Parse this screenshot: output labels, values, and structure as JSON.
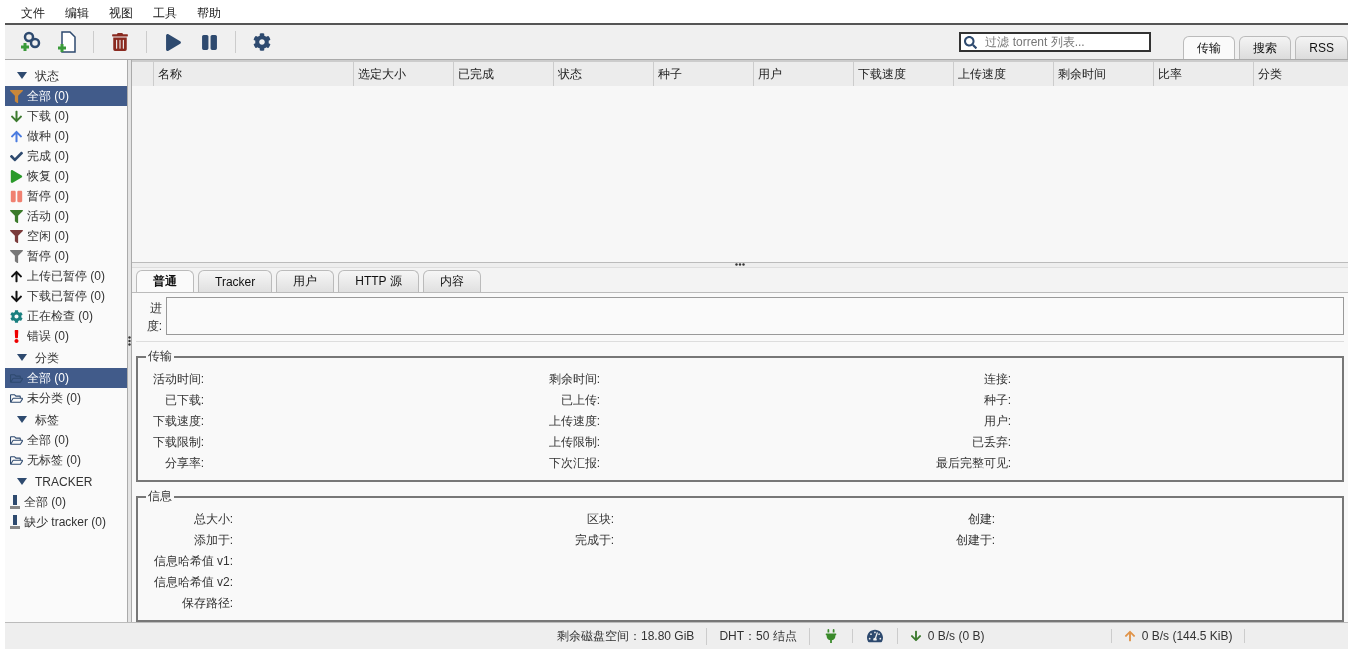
{
  "menu": [
    {
      "label": "文件"
    },
    {
      "label": "编辑"
    },
    {
      "label": "视图"
    },
    {
      "label": "工具"
    },
    {
      "label": "帮助"
    }
  ],
  "toolbar": {
    "filter": {
      "placeholder": "过滤 torrent 列表..."
    }
  },
  "view_tabs": [
    {
      "label": "传输",
      "selected": true
    },
    {
      "label": "搜索",
      "selected": false
    },
    {
      "label": "RSS",
      "selected": false
    }
  ],
  "sidebar": {
    "sections": [
      {
        "title": "状态",
        "expanded": true,
        "items": [
          {
            "label": "全部 (0)",
            "selected": true
          },
          {
            "label": "下载 (0)",
            "selected": false
          },
          {
            "label": "做种 (0)",
            "selected": false
          },
          {
            "label": "完成 (0)",
            "selected": false
          },
          {
            "label": "恢复 (0)",
            "selected": false
          },
          {
            "label": "暂停 (0)",
            "selected": false
          },
          {
            "label": "活动 (0)",
            "selected": false
          },
          {
            "label": "空闲 (0)",
            "selected": false
          },
          {
            "label": "暂停 (0)",
            "selected": false
          },
          {
            "label": "上传已暂停 (0)",
            "selected": false
          },
          {
            "label": "下载已暂停 (0)",
            "selected": false
          },
          {
            "label": "正在检查 (0)",
            "selected": false
          },
          {
            "label": "错误 (0)",
            "selected": false
          }
        ]
      },
      {
        "title": "分类",
        "expanded": true,
        "items": [
          {
            "label": "全部 (0)",
            "selected": true
          },
          {
            "label": "未分类 (0)",
            "selected": false
          }
        ]
      },
      {
        "title": "标签",
        "expanded": true,
        "items": [
          {
            "label": "全部 (0)",
            "selected": false
          },
          {
            "label": "无标签 (0)",
            "selected": false
          }
        ]
      },
      {
        "title": "TRACKER",
        "expanded": true,
        "items": [
          {
            "label": "全部 (0)",
            "selected": false
          },
          {
            "label": "缺少 tracker (0)",
            "selected": false
          }
        ]
      }
    ]
  },
  "table": {
    "columns": [
      "名称",
      "选定大小",
      "已完成",
      "状态",
      "种子",
      "用户",
      "下载速度",
      "上传速度",
      "剩余时间",
      "比率",
      "分类"
    ]
  },
  "detail_tabs": [
    {
      "label": "普通",
      "selected": true
    },
    {
      "label": "Tracker",
      "selected": false
    },
    {
      "label": "用户",
      "selected": false
    },
    {
      "label": "HTTP 源",
      "selected": false
    },
    {
      "label": "内容",
      "selected": false
    }
  ],
  "progress": {
    "label": "进度:",
    "level": 0
  },
  "transfer": {
    "title": "传输",
    "rows": [
      [
        "活动时间:",
        "剩余时间:",
        "连接:"
      ],
      [
        "已下载:",
        "已上传:",
        "种子:"
      ],
      [
        "下载速度:",
        "上传速度:",
        "用户:"
      ],
      [
        "下载限制:",
        "上传限制:",
        "已丢弃:"
      ],
      [
        "分享率:",
        "下次汇报:",
        "最后完整可见:"
      ]
    ]
  },
  "info": {
    "title": "信息",
    "rows": [
      [
        "总大小:",
        "区块:",
        "创建:"
      ],
      [
        "添加于:",
        "完成于:",
        "创建于:"
      ],
      [
        "信息哈希值 v1:"
      ],
      [
        "信息哈希值 v2:"
      ],
      [
        "保存路径:"
      ]
    ]
  },
  "status_bar": {
    "free_space": "剩余磁盘空间：18.80 GiB",
    "dht": "DHT：50 结点",
    "download": "0 B/s (0 B)",
    "upload": "0 B/s (144.5 KiB)"
  }
}
